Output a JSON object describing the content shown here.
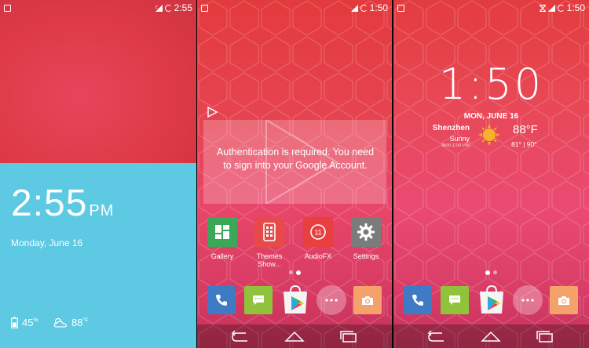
{
  "screen1": {
    "status": {
      "time": "2:55"
    },
    "clock": {
      "time": "2:55",
      "ampm": "PM",
      "date": "Monday, June 16"
    },
    "battery": {
      "value": "45",
      "unit": "%"
    },
    "weather": {
      "value": "88",
      "unit": "°F"
    }
  },
  "screen2": {
    "status": {
      "time": "1:50"
    },
    "auth_message": "Authentication is required. You need to sign into your Google Account.",
    "apps": [
      {
        "label": "Gallery",
        "icon": "gallery-icon",
        "color": "#3aa857"
      },
      {
        "label": "Themes Show...",
        "icon": "themes-icon",
        "color": "#e84a4a"
      },
      {
        "label": "AudioFX",
        "icon": "audiofx-icon",
        "color": "#e84040"
      },
      {
        "label": "Settings",
        "icon": "gear-icon",
        "color": "#7b7b7b"
      }
    ],
    "dock": [
      "phone-icon",
      "messaging-icon",
      "play-store-icon",
      "app-drawer-icon",
      "camera-icon"
    ]
  },
  "screen3": {
    "status": {
      "time": "1:50"
    },
    "clock": {
      "time": "1:50",
      "date": "MON, JUNE 16"
    },
    "weather": {
      "city": "Shenzhen",
      "condition": "Sunny",
      "updated": "Mon 1:00 PM",
      "temp": "88°F",
      "range": "81° | 90°"
    },
    "dock": [
      "phone-icon",
      "messaging-icon",
      "play-store-icon",
      "app-drawer-icon",
      "camera-icon"
    ]
  },
  "colors": {
    "cyan_card": "#5ec9e2",
    "phone": "#3f7bc4",
    "messaging": "#8fc33b",
    "camera": "#f4a26a"
  }
}
